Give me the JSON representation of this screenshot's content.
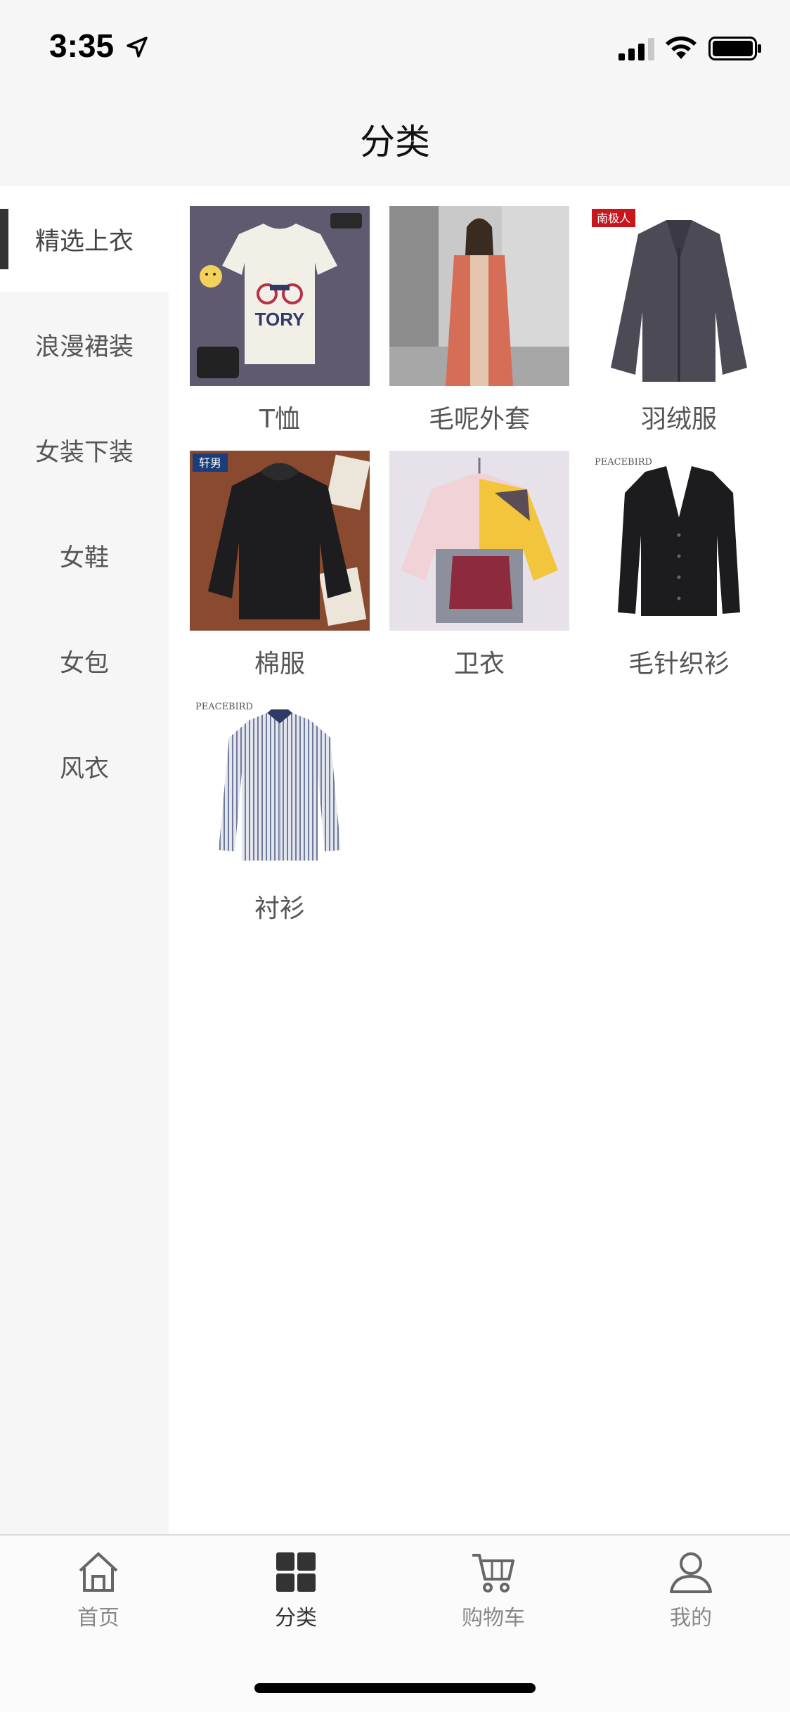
{
  "status_bar": {
    "time": "3:35"
  },
  "header": {
    "title": "分类"
  },
  "sidebar": {
    "items": [
      {
        "label": "精选上衣",
        "active": true
      },
      {
        "label": "浪漫裙装",
        "active": false
      },
      {
        "label": "女装下装",
        "active": false
      },
      {
        "label": "女鞋",
        "active": false
      },
      {
        "label": "女包",
        "active": false
      },
      {
        "label": "风衣",
        "active": false
      }
    ]
  },
  "grid": {
    "items": [
      {
        "label": "T恤",
        "image": "white-tshirt",
        "brand_text": "TORY"
      },
      {
        "label": "毛呢外套",
        "image": "coral-wool-coat"
      },
      {
        "label": "羽绒服",
        "image": "gray-down-jacket",
        "brand_text": "南极人"
      },
      {
        "label": "棉服",
        "image": "black-padded-jacket",
        "brand_text": "轩男"
      },
      {
        "label": "卫衣",
        "image": "colorblock-hoodie"
      },
      {
        "label": "毛针织衫",
        "image": "black-cardigan",
        "brand_text": "PEACEBIRD"
      },
      {
        "label": "衬衫",
        "image": "striped-shirt",
        "brand_text": "PEACEBIRD"
      }
    ]
  },
  "tabbar": {
    "tabs": [
      {
        "label": "首页",
        "icon": "home-icon",
        "active": false
      },
      {
        "label": "分类",
        "icon": "grid-icon",
        "active": true
      },
      {
        "label": "购物车",
        "icon": "cart-icon",
        "active": false
      },
      {
        "label": "我的",
        "icon": "user-icon",
        "active": false
      }
    ]
  },
  "colors": {
    "sidebar_bg": "#f6f6f6",
    "active_indicator": "#333333",
    "label_text": "#555555",
    "inactive_tab": "#888888"
  }
}
